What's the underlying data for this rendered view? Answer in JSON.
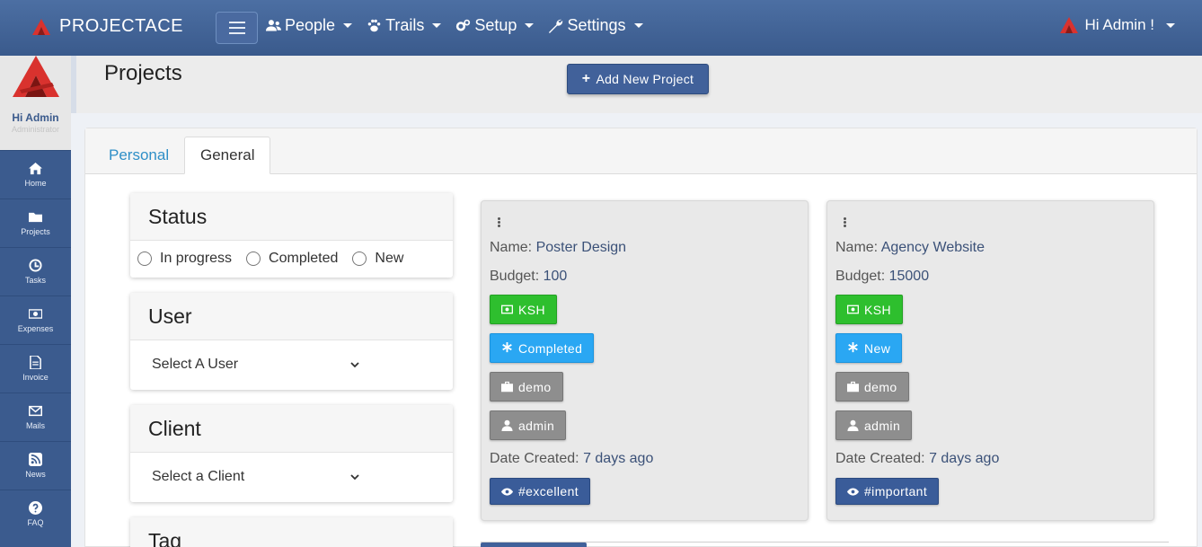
{
  "brand": {
    "name": "PROJECTACE"
  },
  "nav": {
    "items": [
      {
        "label": "People",
        "icon": "users-icon"
      },
      {
        "label": "Trails",
        "icon": "paw-icon"
      },
      {
        "label": "Setup",
        "icon": "cogs-icon"
      },
      {
        "label": "Settings",
        "icon": "wrench-icon"
      }
    ],
    "user_label": "Hi Admin !"
  },
  "sidebar": {
    "profile_name": "Hi Admin",
    "profile_role": "Administrator",
    "items": [
      {
        "label": "Home",
        "icon": "home-icon"
      },
      {
        "label": "Projects",
        "icon": "folder-icon"
      },
      {
        "label": "Tasks",
        "icon": "clock-icon"
      },
      {
        "label": "Expenses",
        "icon": "money-icon"
      },
      {
        "label": "Invoice",
        "icon": "document-icon"
      },
      {
        "label": "Mails",
        "icon": "envelope-icon"
      },
      {
        "label": "News",
        "icon": "rss-icon"
      },
      {
        "label": "FAQ",
        "icon": "question-icon"
      }
    ]
  },
  "page": {
    "title": "Projects",
    "add_button": "Add New Project"
  },
  "tabs": [
    {
      "label": "Personal",
      "active": false
    },
    {
      "label": "General",
      "active": true
    }
  ],
  "filters": {
    "status": {
      "title": "Status",
      "options": [
        "In progress",
        "Completed",
        "New"
      ]
    },
    "user": {
      "title": "User",
      "selected": "Select A User"
    },
    "client": {
      "title": "Client",
      "selected": "Select a Client"
    },
    "tag": {
      "title": "Tag"
    }
  },
  "projects": [
    {
      "name_label": "Name:",
      "name": "Poster Design",
      "budget_label": "Budget:",
      "budget": "100",
      "currency": "KSH",
      "status": "Completed",
      "category": "demo",
      "owner": "admin",
      "date_label": "Date Created:",
      "date": "7 days ago",
      "tag": "#excellent"
    },
    {
      "name_label": "Name:",
      "name": "Agency Website",
      "budget_label": "Budget:",
      "budget": "15000",
      "currency": "KSH",
      "status": "New",
      "category": "demo",
      "owner": "admin",
      "date_label": "Date Created:",
      "date": "7 days ago",
      "tag": "#important"
    }
  ],
  "colors": {
    "navbar": "#3f6196",
    "sidebar": "#3b5b8e",
    "badge_currency": "#2ebf2e",
    "badge_status": "#2aa7f3",
    "badge_grey": "#8e8e8e",
    "badge_tag": "#3a5c99",
    "tab_link": "#2f8fc7"
  }
}
